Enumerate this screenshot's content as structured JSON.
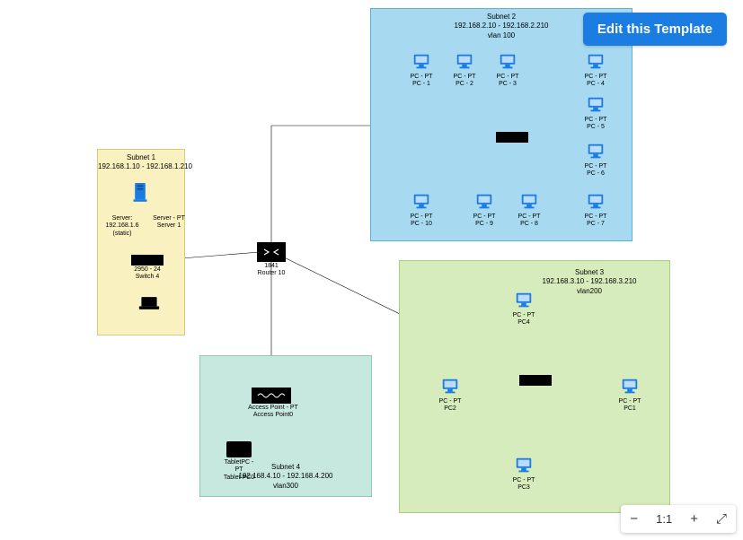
{
  "editButton": "Edit this Template",
  "zoom": {
    "minus": "−",
    "plus": "+",
    "fit": "1:1",
    "expand": "⤢"
  },
  "subnets": {
    "s1": {
      "title": "Subnet 1\n192.168.1.10 - 192.168.1.210"
    },
    "s2": {
      "title": "Subnet 2\n192.168.2.10 - 192.168.2.210\nvlan 100"
    },
    "s3": {
      "title": "Subnet 3\n192.168.3.10 - 192.168.3.210\nvlan200"
    },
    "s4": {
      "title": "Subnet 4\n192.168.4.10 - 192.168.4.200\nvlan300"
    }
  },
  "devices": {
    "server1": {
      "l1": "Server: 192.168.1.6",
      "l2": "(static)",
      "l3": "Server - PT",
      "l4": "Server 1"
    },
    "switch4": {
      "l1": "2950 - 24",
      "l2": "Switch 4"
    },
    "laptop0": {
      "l1": "",
      "l2": ""
    },
    "router": {
      "l1": "1841",
      "l2": "Router 10"
    },
    "ap": {
      "l1": "Access Point - PT",
      "l2": "Access Point0"
    },
    "tablet": {
      "l1": "TabletPC - PT",
      "l2": "Tablet PC0"
    },
    "pc1": {
      "l1": "PC - PT",
      "l2": "PC - 1"
    },
    "pc2": {
      "l1": "PC - PT",
      "l2": "PC - 2"
    },
    "pc3": {
      "l1": "PC - PT",
      "l2": "PC - 3"
    },
    "pc4": {
      "l1": "PC - PT",
      "l2": "PC - 4"
    },
    "pc5": {
      "l1": "PC - PT",
      "l2": "PC - 5"
    },
    "pc6": {
      "l1": "PC - PT",
      "l2": "PC - 6"
    },
    "pc7": {
      "l1": "PC - PT",
      "l2": "PC - 7"
    },
    "pc8": {
      "l1": "PC - PT",
      "l2": "PC - 8"
    },
    "pc9": {
      "l1": "PC - PT",
      "l2": "PC - 9"
    },
    "pc10": {
      "l1": "PC - PT",
      "l2": "PC - 10"
    },
    "s3pc1": {
      "l1": "PC - PT",
      "l2": "PC1"
    },
    "s3pc2": {
      "l1": "PC - PT",
      "l2": "PC2"
    },
    "s3pc3": {
      "l1": "PC - PT",
      "l2": "PC3"
    },
    "s3pc4": {
      "l1": "PC - PT",
      "l2": "PC4"
    }
  },
  "diagram_data": {
    "type": "network-topology",
    "router": {
      "model": "1841",
      "name": "Router 10"
    },
    "subnets": [
      {
        "id": 1,
        "range": "192.168.1.10-192.168.1.210",
        "vlan": null,
        "devices": [
          "Server 1 (192.168.1.6 static)",
          "Switch 4 (2950-24)",
          "Laptop"
        ]
      },
      {
        "id": 2,
        "range": "192.168.2.10-192.168.2.210",
        "vlan": 100,
        "devices": [
          "Switch",
          "PC-1",
          "PC-2",
          "PC-3",
          "PC-4",
          "PC-5",
          "PC-6",
          "PC-7",
          "PC-8",
          "PC-9",
          "PC-10"
        ]
      },
      {
        "id": 3,
        "range": "192.168.3.10-192.168.3.210",
        "vlan": 200,
        "devices": [
          "Switch",
          "PC1",
          "PC2",
          "PC3",
          "PC4"
        ]
      },
      {
        "id": 4,
        "range": "192.168.4.10-192.168.4.200",
        "vlan": 300,
        "devices": [
          "Access Point0",
          "Tablet PC0"
        ]
      }
    ],
    "links": [
      [
        "Router 10",
        "Switch 4"
      ],
      [
        "Router 10",
        "Subnet2 Switch"
      ],
      [
        "Router 10",
        "Subnet3 Switch"
      ],
      [
        "Router 10",
        "Access Point0"
      ],
      [
        "Switch 4",
        "Server 1"
      ],
      [
        "Switch 4",
        "Laptop"
      ],
      [
        "Access Point0",
        "Tablet PC0"
      ],
      [
        "Subnet2 Switch",
        "PC-1..PC-10"
      ],
      [
        "Subnet3 Switch",
        "PC1..PC4"
      ]
    ]
  }
}
